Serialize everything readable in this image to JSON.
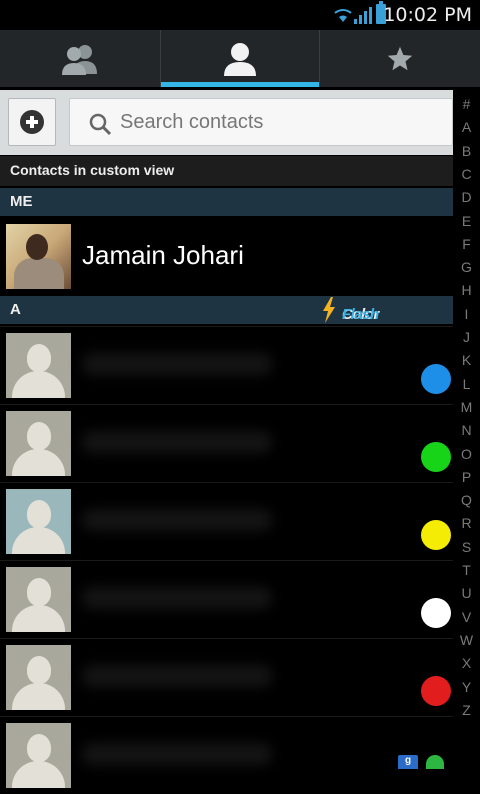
{
  "status_bar": {
    "time": "10:02 PM"
  },
  "tabs": [
    {
      "icon": "groups-icon",
      "active": false
    },
    {
      "icon": "contact-icon",
      "active": true
    },
    {
      "icon": "favorites-star-icon",
      "active": false
    }
  ],
  "search": {
    "placeholder": "Search contacts"
  },
  "custom_view_label": "Contacts in custom view",
  "sections": {
    "me": "ME",
    "a": "A"
  },
  "brand": {
    "part1": "Color",
    "part2": "Flash"
  },
  "me": {
    "name": "Jamain Johari"
  },
  "contacts": [
    {
      "dot_color": "#1e8fe8"
    },
    {
      "dot_color": "#18d418"
    },
    {
      "dot_color": "#f4ec05"
    },
    {
      "dot_color": "#ffffff"
    },
    {
      "dot_color": "#e21d1d"
    },
    {
      "dot_color": null
    }
  ],
  "alphabet": [
    "#",
    "A",
    "B",
    "C",
    "D",
    "E",
    "F",
    "G",
    "H",
    "I",
    "J",
    "K",
    "L",
    "M",
    "N",
    "O",
    "P",
    "Q",
    "R",
    "S",
    "T",
    "U",
    "V",
    "W",
    "X",
    "Y",
    "Z"
  ],
  "colors": {
    "accent": "#33b5e5",
    "section_bg": "#1f3442"
  }
}
